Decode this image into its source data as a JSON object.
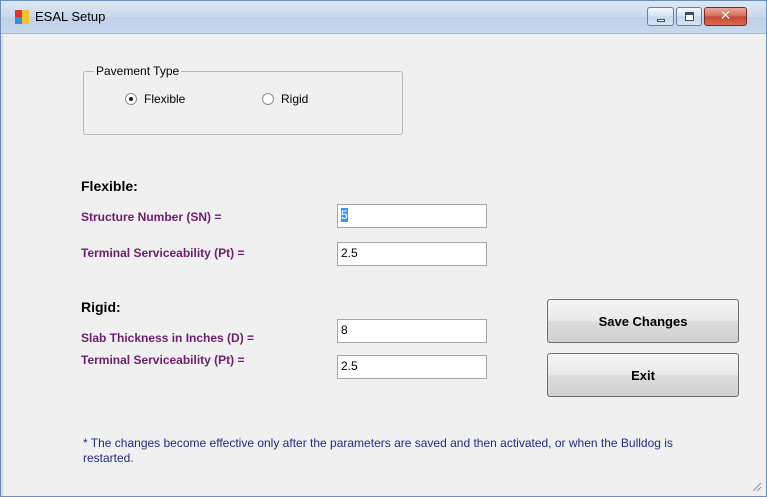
{
  "window": {
    "title": "ESAL Setup"
  },
  "controls": {
    "minimize": "minimize",
    "maximize": "maximize",
    "close": "✕"
  },
  "pavement_type": {
    "legend": "Pavement Type",
    "options": [
      {
        "label": "Flexible",
        "selected": true
      },
      {
        "label": "Rigid",
        "selected": false
      }
    ]
  },
  "flexible": {
    "heading": "Flexible:",
    "sn_label": "Structure Number (SN) =",
    "sn_value": "5",
    "pt_label": "Terminal Serviceability (Pt) =",
    "pt_value": "2.5"
  },
  "rigid": {
    "heading": "Rigid:",
    "d_label": "Slab Thickness in Inches (D) =",
    "d_value": "8",
    "pt_label": "Terminal Serviceability (Pt) =",
    "pt_value": "2.5"
  },
  "buttons": {
    "save": "Save Changes",
    "exit": "Exit"
  },
  "note": "* The changes become effective only after the parameters are saved and then activated, or when the Bulldog is restarted.",
  "colors": {
    "label": "#6d1e6e",
    "note": "#1e2b8a",
    "selection": "#3399ff"
  }
}
